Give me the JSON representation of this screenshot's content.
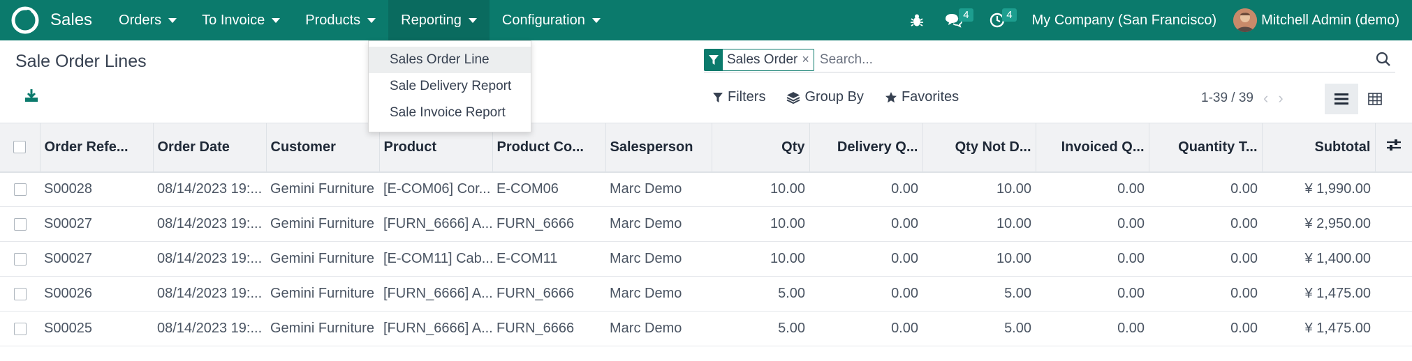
{
  "navbar": {
    "app_name": "Sales",
    "menu": [
      {
        "label": "Orders"
      },
      {
        "label": "To Invoice"
      },
      {
        "label": "Products"
      },
      {
        "label": "Reporting"
      },
      {
        "label": "Configuration"
      }
    ],
    "messages_count": "4",
    "activities_count": "4",
    "company": "My Company (San Francisco)",
    "user": "Mitchell Admin (demo)",
    "brand_color": "#0b7a6c"
  },
  "reporting_dropdown": {
    "items": [
      {
        "label": "Sales Order Line"
      },
      {
        "label": "Sale Delivery Report"
      },
      {
        "label": "Sale Invoice Report"
      }
    ]
  },
  "control_panel": {
    "title": "Sale Order Lines",
    "facet_label": "Sales Order",
    "facet_close": "×",
    "search_placeholder": "Search...",
    "filters_label": "Filters",
    "group_by_label": "Group By",
    "favorites_label": "Favorites",
    "pager": "1-39 / 39"
  },
  "table": {
    "columns": [
      "Order Refe...",
      "Order Date",
      "Customer",
      "Product",
      "Product Co...",
      "Salesperson",
      "Qty",
      "Delivery Q...",
      "Qty Not D...",
      "Invoiced Q...",
      "Quantity T...",
      "Subtotal"
    ],
    "rows": [
      [
        "S00028",
        "08/14/2023 19:...",
        "Gemini Furniture",
        "[E-COM06] Cor...",
        "E-COM06",
        "Marc Demo",
        "10.00",
        "0.00",
        "10.00",
        "0.00",
        "0.00",
        "¥ 1,990.00"
      ],
      [
        "S00027",
        "08/14/2023 19:...",
        "Gemini Furniture",
        "[FURN_6666] A...",
        "FURN_6666",
        "Marc Demo",
        "10.00",
        "0.00",
        "10.00",
        "0.00",
        "0.00",
        "¥ 2,950.00"
      ],
      [
        "S00027",
        "08/14/2023 19:...",
        "Gemini Furniture",
        "[E-COM11] Cab...",
        "E-COM11",
        "Marc Demo",
        "10.00",
        "0.00",
        "10.00",
        "0.00",
        "0.00",
        "¥ 1,400.00"
      ],
      [
        "S00026",
        "08/14/2023 19:...",
        "Gemini Furniture",
        "[FURN_6666] A...",
        "FURN_6666",
        "Marc Demo",
        "5.00",
        "0.00",
        "5.00",
        "0.00",
        "0.00",
        "¥ 1,475.00"
      ],
      [
        "S00025",
        "08/14/2023 19:...",
        "Gemini Furniture",
        "[FURN_6666] A...",
        "FURN_6666",
        "Marc Demo",
        "5.00",
        "0.00",
        "5.00",
        "0.00",
        "0.00",
        "¥ 1,475.00"
      ]
    ]
  }
}
